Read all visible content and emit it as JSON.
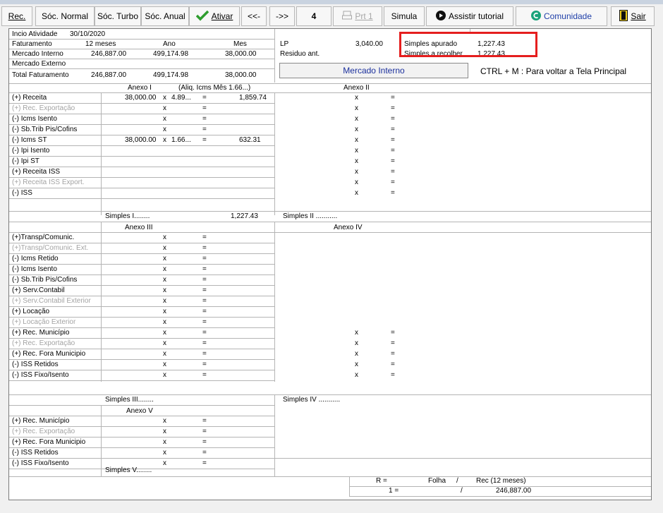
{
  "toolbar": {
    "rec": "Rec.",
    "soc_normal": "Sóc. Normal",
    "soc_turbo": "Sóc. Turbo",
    "soc_anual": "Sóc. Anual",
    "ativar": "Ativar",
    "prev": "<<-",
    "next": "->>",
    "page": "4",
    "prt": "Prt 1",
    "simula": "Simula",
    "tutorial": "Assistir tutorial",
    "comunidade": "Comunidade",
    "sair": "Sair"
  },
  "header": {
    "inicio_label": "Incio Atividade",
    "inicio_date": "30/10/2020",
    "faturamento_label": "Faturamento",
    "col_12": "12 meses",
    "col_ano": "Ano",
    "col_mes": "Mes",
    "mi_label": "Mercado Interno",
    "mi_12": "246,887.00",
    "mi_ano": "499,174.98",
    "mi_mes": "38,000.00",
    "me_label": "Mercado Externo",
    "total_label": "Total Faturamento",
    "total_12": "246,887.00",
    "total_ano": "499,174.98",
    "total_mes": "38,000.00",
    "lp_label": "LP",
    "lp_value": "3,040.00",
    "residuo_label": "Residuo ant.",
    "simples_apurado_label": "Simples apurado",
    "simples_apurado_value": "1,227.43",
    "simples_recolher_label": "Simples a recolher",
    "simples_recolher_value": "1,227.43",
    "mercado_interno_btn": "Mercado Interno",
    "ctrl_hint": "CTRL + M  :  Para voltar a Tela Principal"
  },
  "anexo1": {
    "title": "Anexo I",
    "aliq": "(Aliq. Icms Mês 1.66...)",
    "rows": [
      {
        "label": "(+) Receita",
        "value": "38,000.00",
        "x": "x",
        "rate": "4.89...",
        "eq": "=",
        "result": "1,859.74",
        "dim": false
      },
      {
        "label": "(+) Rec. Exportação",
        "value": "",
        "x": "x",
        "rate": "",
        "eq": "=",
        "result": "",
        "dim": true
      },
      {
        "label": "(-) Icms Isento",
        "value": "",
        "x": "x",
        "rate": "",
        "eq": "=",
        "result": "",
        "dim": false
      },
      {
        "label": "(-) Sb.Trib Pis/Cofins",
        "value": "",
        "x": "x",
        "rate": "",
        "eq": "=",
        "result": "",
        "dim": false
      },
      {
        "label": "(-) Icms ST",
        "value": "38,000.00",
        "x": "x",
        "rate": "1.66...",
        "eq": "=",
        "result": "632.31",
        "dim": false
      },
      {
        "label": "(-) Ipi Isento",
        "value": "",
        "x": "",
        "rate": "",
        "eq": "",
        "result": "",
        "dim": false
      },
      {
        "label": "(-) Ipi ST",
        "value": "",
        "x": "",
        "rate": "",
        "eq": "",
        "result": "",
        "dim": false
      },
      {
        "label": "(+) Receita ISS",
        "value": "",
        "x": "",
        "rate": "",
        "eq": "",
        "result": "",
        "dim": false
      },
      {
        "label": "(+) Receita ISS Export.",
        "value": "",
        "x": "",
        "rate": "",
        "eq": "",
        "result": "",
        "dim": true
      },
      {
        "label": "(-) ISS",
        "value": "",
        "x": "",
        "rate": "",
        "eq": "",
        "result": "",
        "dim": false
      }
    ],
    "simples_label": "Simples I........",
    "simples_value": "1,227.43"
  },
  "anexo2": {
    "title": "Anexo II",
    "rows_x": [
      "x",
      "x",
      "x",
      "x",
      "x",
      "x",
      "x",
      "x",
      "x",
      "x"
    ],
    "simples_label": "Simples II ..........."
  },
  "anexo3": {
    "title": "Anexo III",
    "rows": [
      {
        "label": "(+)Transp/Comunic.",
        "dim": false
      },
      {
        "label": "(+)Transp/Comunic. Ext.",
        "dim": true
      },
      {
        "label": "(-) Icms Retido",
        "dim": false
      },
      {
        "label": "(-) Icms Isento",
        "dim": false
      },
      {
        "label": "(-) Sb.Trib Pis/Cofins",
        "dim": false
      },
      {
        "label": "(+) Serv.Contabil",
        "dim": false
      },
      {
        "label": "(+) Serv.Contabil Exterior",
        "dim": true
      },
      {
        "label": "(+) Locação",
        "dim": false
      },
      {
        "label": "(+) Locação Exterior",
        "dim": true
      },
      {
        "label": "(+) Rec. Município",
        "dim": false
      },
      {
        "label": "(+) Rec. Exportação",
        "dim": true
      },
      {
        "label": "(+) Rec. Fora Municipio",
        "dim": false
      },
      {
        "label": "(-) ISS Retidos",
        "dim": false
      },
      {
        "label": "(-) ISS Fixo/Isento",
        "dim": false
      }
    ],
    "simples_label": "Simples III........"
  },
  "anexo4": {
    "title": "Anexo IV",
    "simples_label": "Simples IV ..........."
  },
  "anexo5": {
    "title": "Anexo V",
    "rows": [
      {
        "label": "(+) Rec. Município",
        "dim": false
      },
      {
        "label": "(+) Rec. Exportação",
        "dim": true
      },
      {
        "label": "(+) Rec. Fora Municipio",
        "dim": false
      },
      {
        "label": "(-) ISS Retidos",
        "dim": false
      },
      {
        "label": "(-) ISS Fixo/Isento",
        "dim": false
      }
    ],
    "simples_label": "Simples V........"
  },
  "r_box": {
    "r": "R  =",
    "folha": "Folha",
    "slash": "/",
    "rec": "Rec (12 meses)",
    "one": "1 =",
    "slash2": "/",
    "value": "246,887.00"
  },
  "symbols": {
    "x": "x",
    "eq": "="
  }
}
